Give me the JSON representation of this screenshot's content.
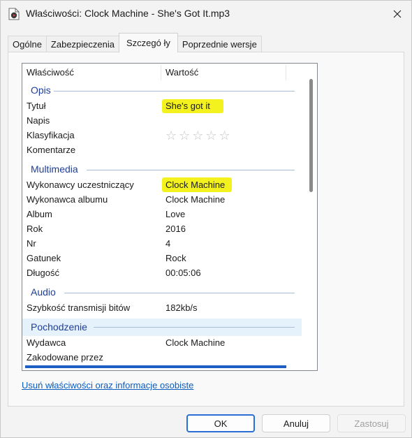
{
  "window": {
    "title": "Właściwości: Clock Machine - She's Got It.mp3",
    "close_icon": "close-icon",
    "app_icon": "media-file-icon"
  },
  "tabs": [
    {
      "label": "Ogólne",
      "active": false
    },
    {
      "label": "Zabezpieczenia",
      "active": false
    },
    {
      "label": "Szczegó ły",
      "active": true
    },
    {
      "label": "Poprzednie wersje",
      "active": false
    }
  ],
  "details": {
    "columns": {
      "property": "Właściwość",
      "value": "Wartość"
    },
    "groups": {
      "opis": "Opis",
      "multimedia": "Multimedia",
      "audio": "Audio",
      "pochodzenie": "Pochodzenie"
    },
    "rows": {
      "tytul": {
        "name": "Tytuł",
        "value": "She's got it"
      },
      "napis": {
        "name": "Napis",
        "value": ""
      },
      "klasyfikacja": {
        "name": "Klasyfikacja",
        "value": "☆☆☆☆☆",
        "rating": 0,
        "max": 5
      },
      "komentarze": {
        "name": "Komentarze",
        "value": ""
      },
      "wykonawcy": {
        "name": "Wykonawcy uczestniczący",
        "value": "Clock Machine"
      },
      "wykonawca_albumu": {
        "name": "Wykonawca albumu",
        "value": "Clock Machine"
      },
      "album": {
        "name": "Album",
        "value": "Love"
      },
      "rok": {
        "name": "Rok",
        "value": "2016"
      },
      "nr": {
        "name": "Nr",
        "value": "4"
      },
      "gatunek": {
        "name": "Gatunek",
        "value": "Rock"
      },
      "dlugosc": {
        "name": "Długość",
        "value": "00:05:06"
      },
      "bitrate": {
        "name": "Szybkość transmisji bitów",
        "value": "182kb/s"
      },
      "wydawca": {
        "name": "Wydawca",
        "value": "Clock Machine"
      },
      "zakodowane": {
        "name": "Zakodowane przez",
        "value": ""
      }
    },
    "highlight_color": "#f4f21e",
    "group_color": "#1e3e9a"
  },
  "link": {
    "label": "Usuń właściwości oraz informacje osobiste"
  },
  "buttons": {
    "ok": "OK",
    "cancel": "Anuluj",
    "apply": "Zastosuj"
  },
  "accent": "#2a6fd6"
}
